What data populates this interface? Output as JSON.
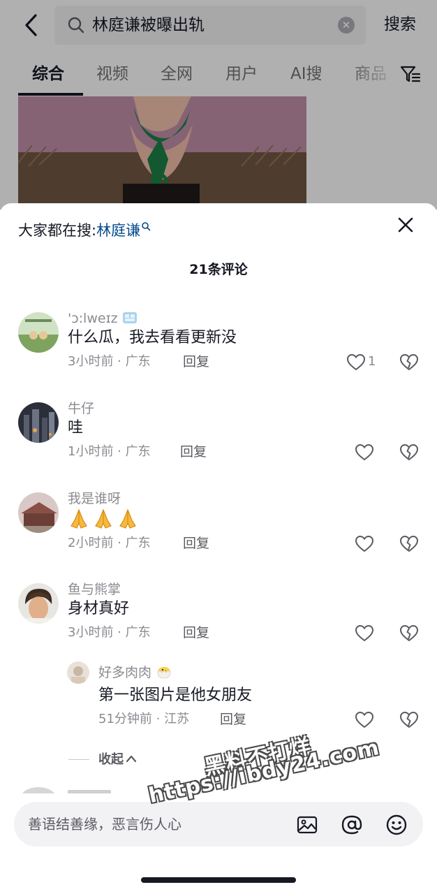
{
  "header": {
    "query": "林庭谦被曝出轨",
    "search_label": "搜索"
  },
  "tabs": [
    {
      "label": "综合",
      "active": true
    },
    {
      "label": "视频"
    },
    {
      "label": "全网"
    },
    {
      "label": "用户"
    },
    {
      "label": "AI搜"
    },
    {
      "label": "商品"
    }
  ],
  "sheet": {
    "suggest_prefix": "大家都在搜:",
    "suggest_keyword": "林庭谦",
    "count": "21条评论"
  },
  "comments": [
    {
      "name": "'ɔ:lweɪz",
      "text": "什么瓜，我去看看更新没",
      "meta": "3小时前 · 广东",
      "reply": "回复",
      "likes": "1"
    },
    {
      "name": "牛仔",
      "text": "哇",
      "meta": "1小时前 · 广东",
      "reply": "回复",
      "likes": ""
    },
    {
      "name": "我是谁呀",
      "text": "🙏🙏🙏",
      "meta": "2小时前 · 广东",
      "reply": "回复",
      "likes": ""
    },
    {
      "name": "鱼与熊掌",
      "text": "身材真好",
      "meta": "3小时前 · 广东",
      "reply": "回复",
      "likes": ""
    }
  ],
  "sub_reply": {
    "name": "好多肉肉",
    "text": "第一张图片是他女朋友",
    "meta": "51分钟前 · 江苏",
    "reply": "回复"
  },
  "collapse_label": "收起",
  "input": {
    "placeholder": "善语结善缘，恶言伤人心"
  },
  "watermark": {
    "line1": "黑料不打烊",
    "line2": "https://ibdy24.com"
  },
  "colors": {
    "accent_link": "#04498d",
    "text_primary": "#161823",
    "text_secondary": "#8a8b91"
  }
}
